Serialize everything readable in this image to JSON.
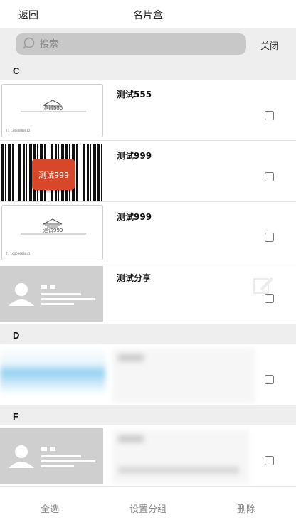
{
  "header": {
    "back_label": "返回",
    "title": "名片盒"
  },
  "search": {
    "placeholder": "搜索",
    "close_label": "关闭"
  },
  "sections": [
    {
      "letter": "C"
    },
    {
      "letter": "D"
    },
    {
      "letter": "F"
    }
  ],
  "cards": [
    {
      "name": "测试555",
      "card_logo_text": "测试555",
      "card_phone": "T：13488888812"
    },
    {
      "name": "测试999",
      "sticker_text": "测试999"
    },
    {
      "name": "测试999",
      "card_logo_text": "测试999",
      "card_phone": "T：16609668641"
    },
    {
      "name": "测试分享"
    }
  ],
  "footer": {
    "select_all": "全选",
    "set_group": "设置分组",
    "delete": "删除"
  },
  "colors": {
    "sticker_red": "#d9472b",
    "section_bg": "#eeeeee",
    "search_bg": "#c8c8c8"
  }
}
